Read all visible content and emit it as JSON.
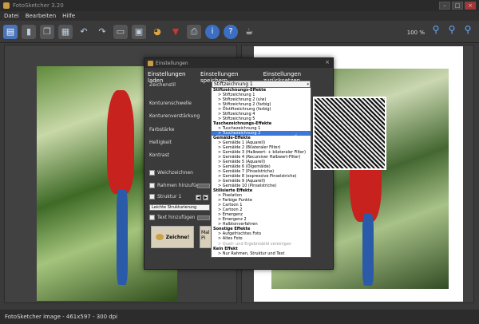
{
  "window": {
    "title": "FotoSketcher 3.20"
  },
  "menu": [
    "Datei",
    "Bearbeiten",
    "Hilfe"
  ],
  "toolbar": {
    "icons": [
      "open-icon",
      "save-icon",
      "copy-icon",
      "paste-icon",
      "undo-icon",
      "redo-icon",
      "compare-icon",
      "settings-icon",
      "palette-icon",
      "paint-icon",
      "print-icon",
      "info-icon",
      "help-icon",
      "coffee-icon"
    ],
    "zoom_label": "100 %",
    "zoom_icons": [
      "zoom-in-icon",
      "zoom-fit-icon",
      "zoom-out-icon"
    ]
  },
  "dialog": {
    "title": "Einstellungen",
    "menu": [
      "Einstellungen laden",
      "Einstellungen speichern",
      "Einstellungen zurücksetzen"
    ],
    "style_label": "Zeichenstil",
    "style_value": "Stiftzeichnung 1",
    "labels": [
      "Konturenschwelle",
      "Konturenverstärkung",
      "Farbstärke",
      "Helligkeit",
      "Kontrast"
    ],
    "checkboxes": {
      "soft": "Weichzeichnen",
      "frame": "Rahmen hinzufügen",
      "texture": "Struktur 1",
      "text": "Text hinzufügen"
    },
    "texture_select": "Leichte Strukturierung",
    "draw_button": "Zeichne!",
    "mask_button": "Mal Pi"
  },
  "style_list": [
    {
      "type": "group",
      "label": "Stiftzeichnungs-Effekte"
    },
    {
      "type": "item",
      "label": "> Stiftzeichnung 1"
    },
    {
      "type": "item",
      "label": "> Stiftzeichnung 2 (s/w)"
    },
    {
      "type": "item",
      "label": "> Stiftzeichnung 2 (farbig)"
    },
    {
      "type": "item",
      "label": "> Ölstiftzeichnung (farbig)"
    },
    {
      "type": "item",
      "label": "> Stiftzeichnung 4"
    },
    {
      "type": "item",
      "label": "> Stiftzeichnung 5"
    },
    {
      "type": "group",
      "label": "Tuschezeichnungs-Effekte"
    },
    {
      "type": "item",
      "label": "> Tuschezeichnung 1"
    },
    {
      "type": "item",
      "label": "> Tuschezeichnung 2",
      "selected": true
    },
    {
      "type": "group",
      "label": "Gemälde-Effekte"
    },
    {
      "type": "item",
      "label": "> Gemälde 1 (Aquarell)"
    },
    {
      "type": "item",
      "label": "> Gemälde 2 (Bilateraler Filter)"
    },
    {
      "type": "item",
      "label": "> Gemälde 3 (Halbwert- + bilateraler Filter)"
    },
    {
      "type": "item",
      "label": "> Gemälde 4 (Recursiver Halbwert-Filter)"
    },
    {
      "type": "item",
      "label": "> Gemälde 5 (Aquarell)"
    },
    {
      "type": "item",
      "label": "> Gemälde 6 (Ölgemälde)"
    },
    {
      "type": "item",
      "label": "> Gemälde 7 (Pinselstriche)"
    },
    {
      "type": "item",
      "label": "> Gemälde 8 (expressive Pinselstriche)"
    },
    {
      "type": "item",
      "label": "> Gemälde 9 (Aquarell)"
    },
    {
      "type": "item",
      "label": "> Gemälde 10 (Pinselstriche)"
    },
    {
      "type": "group",
      "label": "Stilisierte Effekte"
    },
    {
      "type": "item",
      "label": "> Pixelation"
    },
    {
      "type": "item",
      "label": "> Farbige Punkte"
    },
    {
      "type": "item",
      "label": "> Cartoon 1"
    },
    {
      "type": "item",
      "label": "> Cartoon 2"
    },
    {
      "type": "item",
      "label": "> Emergenz"
    },
    {
      "type": "item",
      "label": "> Emergenz 2"
    },
    {
      "type": "item",
      "label": "> Halbtonverfahren"
    },
    {
      "type": "group",
      "label": "Sonstige Effekte"
    },
    {
      "type": "item",
      "label": "> Aufgefrischtes Foto"
    },
    {
      "type": "item",
      "label": "> Altes Foto"
    },
    {
      "type": "item",
      "label": "> Quell- und Ergebnisbild vereinigen",
      "disabled": true
    },
    {
      "type": "group",
      "label": "Kein Effekt"
    },
    {
      "type": "item",
      "label": "> Nur Rahmen, Struktur und Text"
    }
  ],
  "status": "FotoSketcher image - 461x597 - 300 dpi"
}
